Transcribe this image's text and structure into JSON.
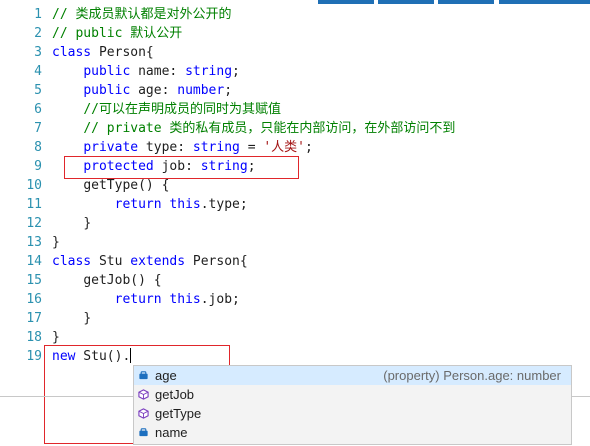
{
  "editor": {
    "line_numbers": [
      "1",
      "2",
      "3",
      "4",
      "5",
      "6",
      "7",
      "8",
      "9",
      "10",
      "11",
      "12",
      "13",
      "14",
      "15",
      "16",
      "17",
      "18",
      "19"
    ],
    "lines": [
      {
        "indent": "",
        "tokens": [
          {
            "t": "// 类成员默认都是对外公开的",
            "c": "cm"
          }
        ]
      },
      {
        "indent": "",
        "tokens": [
          {
            "t": "// public 默认公开",
            "c": "cm"
          }
        ]
      },
      {
        "indent": "",
        "tokens": [
          {
            "t": "class",
            "c": "kw"
          },
          {
            "t": " Person{",
            "c": ""
          }
        ]
      },
      {
        "indent": "    ",
        "tokens": [
          {
            "t": "public",
            "c": "kw"
          },
          {
            "t": " name: ",
            "c": ""
          },
          {
            "t": "string",
            "c": "kw"
          },
          {
            "t": ";",
            "c": ""
          }
        ]
      },
      {
        "indent": "    ",
        "tokens": [
          {
            "t": "public",
            "c": "kw"
          },
          {
            "t": " age: ",
            "c": ""
          },
          {
            "t": "number",
            "c": "kw"
          },
          {
            "t": ";",
            "c": ""
          }
        ]
      },
      {
        "indent": "    ",
        "tokens": [
          {
            "t": "//可以在声明成员的同时为其赋值",
            "c": "cm"
          }
        ]
      },
      {
        "indent": "    ",
        "tokens": [
          {
            "t": "// private 类的私有成员，只能在内部访问，在外部访问不到",
            "c": "cm"
          }
        ]
      },
      {
        "indent": "    ",
        "tokens": [
          {
            "t": "private",
            "c": "kw"
          },
          {
            "t": " type: ",
            "c": ""
          },
          {
            "t": "string",
            "c": "kw"
          },
          {
            "t": " = ",
            "c": ""
          },
          {
            "t": "'人类'",
            "c": "str"
          },
          {
            "t": ";",
            "c": ""
          }
        ]
      },
      {
        "indent": "    ",
        "tokens": [
          {
            "t": "protected",
            "c": "kw"
          },
          {
            "t": " job: ",
            "c": ""
          },
          {
            "t": "string",
            "c": "kw"
          },
          {
            "t": ";",
            "c": ""
          }
        ]
      },
      {
        "indent": "    ",
        "tokens": [
          {
            "t": "getType() {",
            "c": ""
          }
        ]
      },
      {
        "indent": "        ",
        "tokens": [
          {
            "t": "return",
            "c": "kw"
          },
          {
            "t": " ",
            "c": ""
          },
          {
            "t": "this",
            "c": "kw"
          },
          {
            "t": ".type;",
            "c": ""
          }
        ]
      },
      {
        "indent": "    ",
        "tokens": [
          {
            "t": "}",
            "c": ""
          }
        ]
      },
      {
        "indent": "",
        "tokens": [
          {
            "t": "}",
            "c": ""
          }
        ]
      },
      {
        "indent": "",
        "tokens": [
          {
            "t": "class",
            "c": "kw"
          },
          {
            "t": " Stu ",
            "c": ""
          },
          {
            "t": "extends",
            "c": "kw"
          },
          {
            "t": " Person{",
            "c": ""
          }
        ]
      },
      {
        "indent": "    ",
        "tokens": [
          {
            "t": "getJob() {",
            "c": ""
          }
        ]
      },
      {
        "indent": "        ",
        "tokens": [
          {
            "t": "return",
            "c": "kw"
          },
          {
            "t": " ",
            "c": ""
          },
          {
            "t": "this",
            "c": "kw"
          },
          {
            "t": ".job;",
            "c": ""
          }
        ]
      },
      {
        "indent": "    ",
        "tokens": [
          {
            "t": "}",
            "c": ""
          }
        ]
      },
      {
        "indent": "",
        "tokens": [
          {
            "t": "}",
            "c": ""
          }
        ]
      },
      {
        "indent": "",
        "tokens": [
          {
            "t": "new",
            "c": "kw"
          },
          {
            "t": " Stu().",
            "c": ""
          }
        ]
      }
    ]
  },
  "suggestions": {
    "items": [
      {
        "label": "age",
        "kind": "property",
        "detail": "(property) Person.age: number",
        "selected": true
      },
      {
        "label": "getJob",
        "kind": "method",
        "detail": "",
        "selected": false
      },
      {
        "label": "getType",
        "kind": "method",
        "detail": "",
        "selected": false
      },
      {
        "label": "name",
        "kind": "property",
        "detail": "",
        "selected": false
      }
    ]
  },
  "colors": {
    "keyword": "#0000ff",
    "comment": "#008000",
    "string": "#a31515",
    "line_number": "#2b91af",
    "highlight_box": "#e0262b",
    "property_icon": "#1c6fbf",
    "method_icon": "#7b3fbf"
  }
}
